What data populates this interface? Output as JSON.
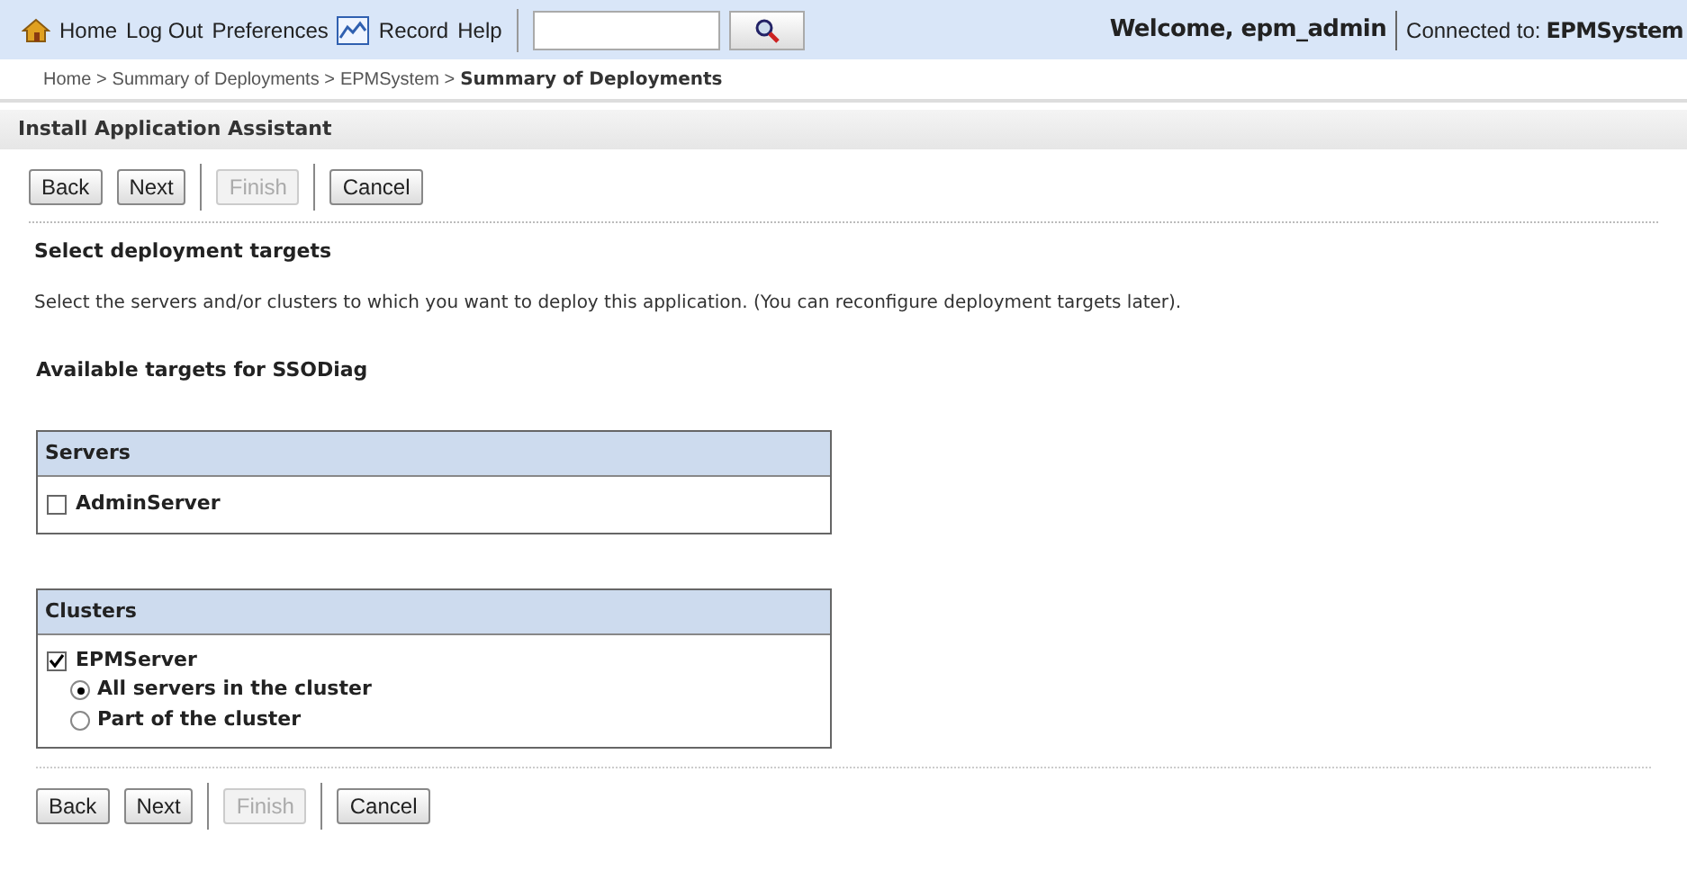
{
  "top_bar": {
    "links": [
      "Home",
      "Log Out",
      "Preferences",
      "Record",
      "Help"
    ],
    "welcome": "Welcome, epm_admin",
    "connected_label": "Connected to:",
    "connected_value": "EPMSystem"
  },
  "breadcrumb": {
    "items": [
      "Home >",
      "Summary of Deployments >",
      "EPMSystem >"
    ],
    "current": "Summary of Deployments"
  },
  "section_title": "Install Application Assistant",
  "top_buttons": [
    {
      "label": "Back",
      "disabled": false
    },
    {
      "label": "Next",
      "disabled": false
    },
    {
      "label": "Finish",
      "disabled": true
    },
    {
      "label": "Cancel",
      "disabled": false
    }
  ],
  "step_title": "Select deployment targets",
  "step_description": "Select the servers and/or clusters to which you want to deploy this application. (You can reconfigure deployment targets later).",
  "available_title": "Available targets for SSODiag",
  "servers": {
    "header": "Servers",
    "items": [
      {
        "label": "AdminServer",
        "checked": false
      }
    ]
  },
  "clusters": {
    "header": "Clusters",
    "items": [
      {
        "label": "EPMServer",
        "checked": true,
        "options": [
          {
            "label": "All servers in the cluster",
            "selected": true
          },
          {
            "label": "Part of the cluster",
            "selected": false
          }
        ]
      }
    ]
  },
  "bottom_buttons": [
    {
      "label": "Back",
      "disabled": false
    },
    {
      "label": "Next",
      "disabled": false
    },
    {
      "label": "Finish",
      "disabled": true
    },
    {
      "label": "Cancel",
      "disabled": false
    }
  ]
}
